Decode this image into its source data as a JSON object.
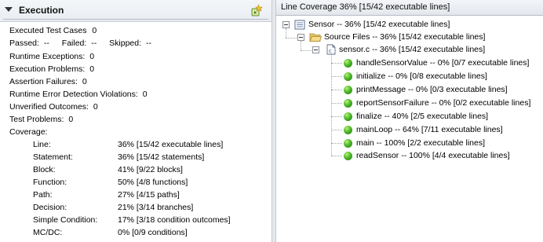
{
  "left_panel": {
    "section_title": "Execution",
    "lines": [
      {
        "label": "Executed Test Cases",
        "value": "0"
      },
      {
        "label": "Passed:",
        "value": "--"
      },
      {
        "label": "Failed:",
        "value": "--"
      },
      {
        "label": "Skipped:",
        "value": "--"
      },
      {
        "label": "Runtime Exceptions:",
        "value": "0"
      },
      {
        "label": "Execution Problems:",
        "value": "0"
      },
      {
        "label": "Assertion Failures:",
        "value": "0"
      },
      {
        "label": "Runtime Error Detection Violations:",
        "value": "0"
      },
      {
        "label": "Unverified Outcomes:",
        "value": "0"
      },
      {
        "label": "Test Problems:",
        "value": "0"
      },
      {
        "label": "Coverage:",
        "value": ""
      }
    ],
    "coverage": [
      {
        "label": "Line:",
        "value": "36% [15/42 executable lines]"
      },
      {
        "label": "Statement:",
        "value": "36% [15/42 statements]"
      },
      {
        "label": "Block:",
        "value": "41% [9/22 blocks]"
      },
      {
        "label": "Function:",
        "value": "50% [4/8 functions]"
      },
      {
        "label": "Path:",
        "value": "27% [4/15 paths]"
      },
      {
        "label": "Decision:",
        "value": "21% [3/14 branches]"
      },
      {
        "label": "Simple Condition:",
        "value": "17% [3/18 condition outcomes]"
      },
      {
        "label": "MC/DC:",
        "value": "0% [0/9 conditions]"
      }
    ]
  },
  "right_panel": {
    "title": "Line Coverage 36% [15/42 executable lines]",
    "tree": {
      "root": "Sensor -- 36% [15/42 executable lines]",
      "folder": "Source Files -- 36% [15/42 executable lines]",
      "file": "sensor.c -- 36% [15/42 executable lines]",
      "functions": [
        "handleSensorValue -- 0% [0/7 executable lines]",
        "initialize -- 0% [0/8 executable lines]",
        "printMessage -- 0% [0/3 executable lines]",
        "reportSensorFailure -- 0% [0/2 executable lines]",
        "finalize -- 40% [2/5 executable lines]",
        "mainLoop -- 64% [7/11 executable lines]",
        "main -- 100% [2/2 executable lines]",
        "readSensor -- 100% [4/4 executable lines]"
      ]
    }
  }
}
